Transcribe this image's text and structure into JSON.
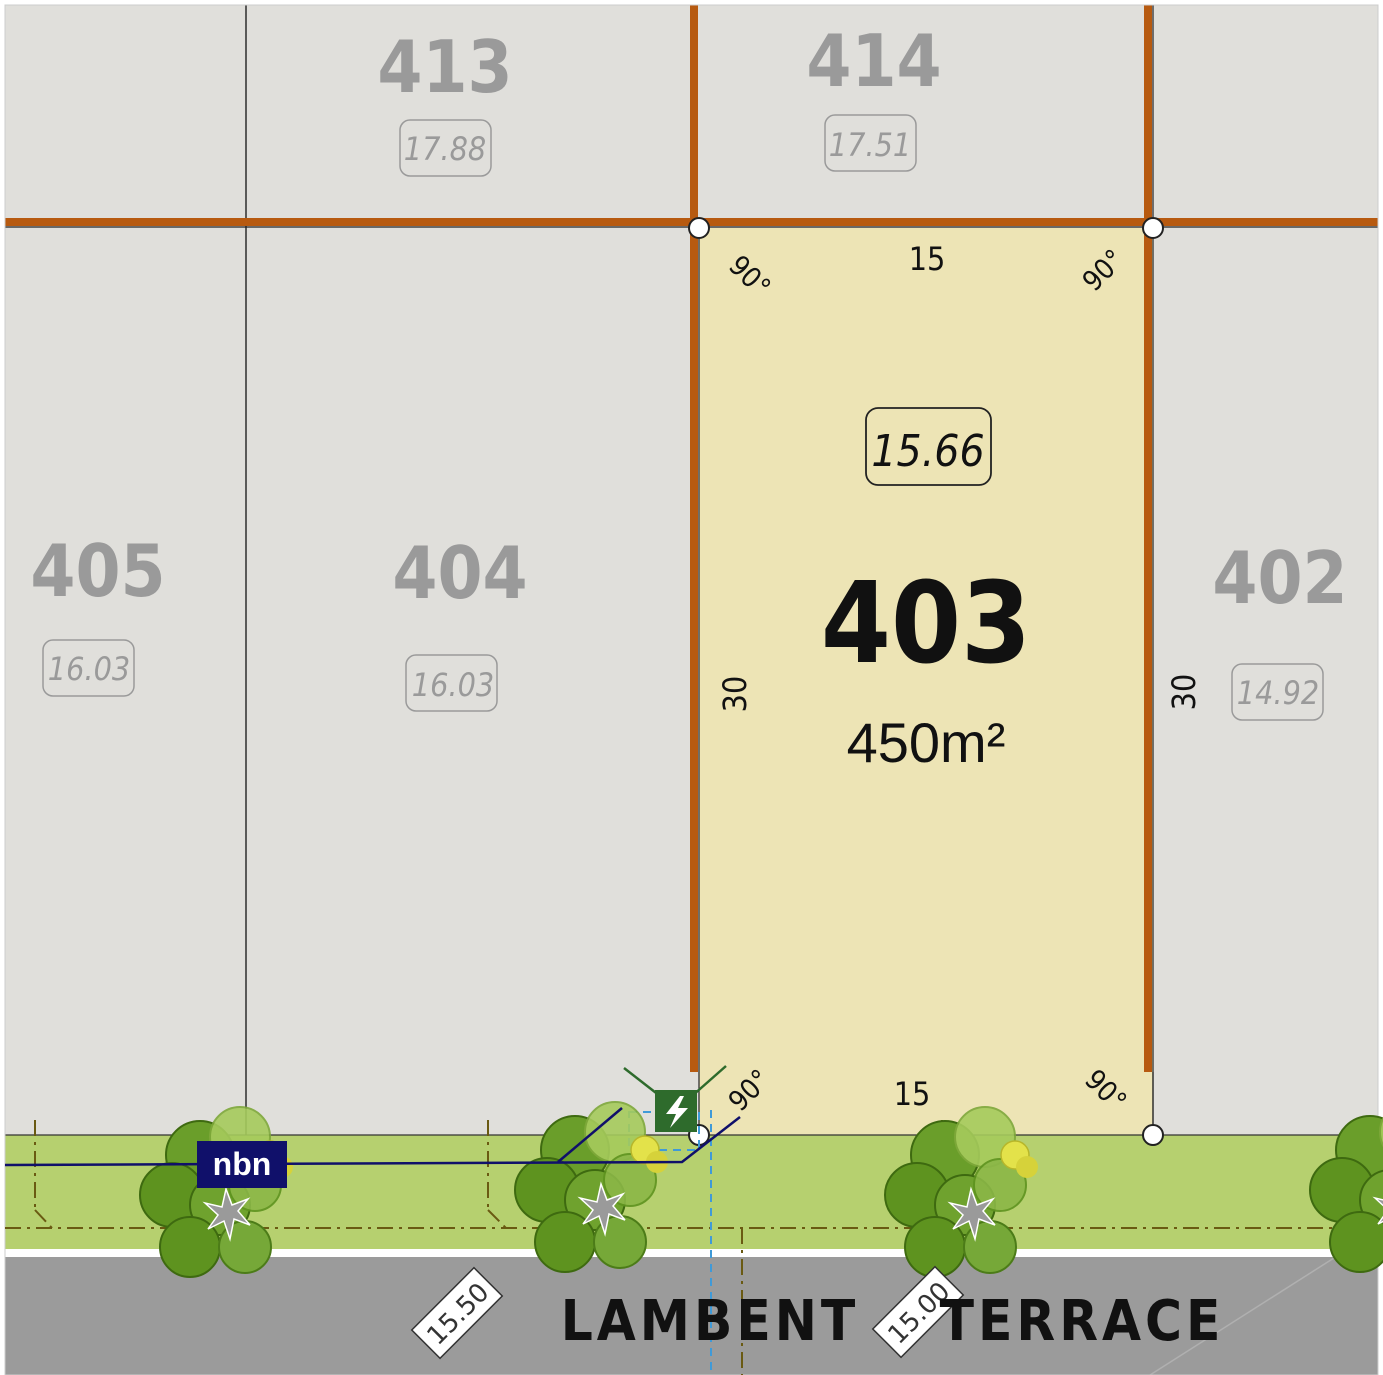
{
  "colors": {
    "lot_grey": "#e0dfdb",
    "lot_selected": "#ede4b5",
    "boundary": "#b75a10",
    "verge": "#b6d06f",
    "road": "#9b9b9b",
    "tree_dark": "#5e931f",
    "tree_light": "#97c04b",
    "nbn": "#10106a",
    "power": "#2e6b2c"
  },
  "lots": {
    "lot_413": {
      "number": "413",
      "elevation": "17.88"
    },
    "lot_414": {
      "number": "414",
      "elevation": "17.51"
    },
    "lot_405": {
      "number": "405",
      "elevation": "16.03"
    },
    "lot_404": {
      "number": "404",
      "elevation": "16.03"
    },
    "lot_402": {
      "number": "402",
      "elevation": "14.92"
    },
    "lot_403": {
      "number": "403",
      "elevation": "15.66",
      "area": "450m²",
      "width_top": "15",
      "width_bottom": "15",
      "depth_left": "30",
      "depth_right": "30",
      "angle": "90°"
    }
  },
  "street": {
    "name_part1": "LAMBENT",
    "name_part2": "TERRACE",
    "level_left": "15.50",
    "level_right": "15.00"
  },
  "services": {
    "nbn_label": "nbn",
    "power_icon": "lightning-bolt-icon"
  }
}
